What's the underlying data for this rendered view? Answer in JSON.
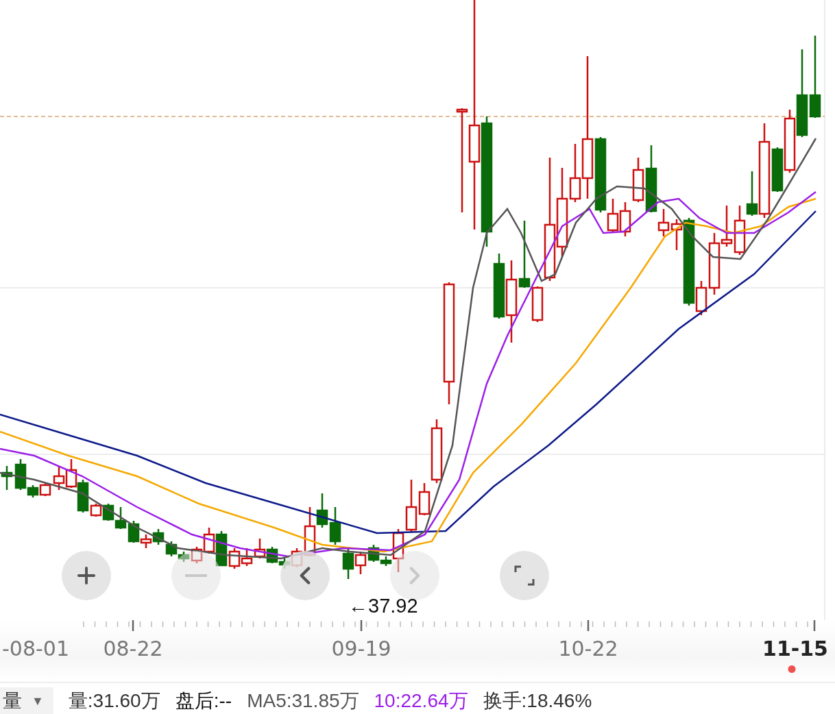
{
  "chart": {
    "price_marker": "←37.92",
    "controls": [
      {
        "kind": "zoom_in",
        "disabled": false
      },
      {
        "kind": "zoom_out",
        "disabled": true
      },
      {
        "kind": "prev",
        "disabled": false
      },
      {
        "kind": "next",
        "disabled": true
      },
      {
        "kind": "fullscreen",
        "disabled": false
      }
    ]
  },
  "x_axis": {
    "labels": [
      {
        "text": "-08-01",
        "selected": false
      },
      {
        "text": "08-22",
        "selected": false
      },
      {
        "text": "09-19",
        "selected": false
      },
      {
        "text": "10-22",
        "selected": false
      },
      {
        "text": "11-15",
        "selected": true
      }
    ]
  },
  "indicator_bar": {
    "selector": {
      "label": "量",
      "caret": "▼"
    },
    "items": [
      {
        "text": "量:31.60万",
        "color": "#333333"
      },
      {
        "text": "盘后:--",
        "color": "#111111"
      },
      {
        "text": "MA5:31.85万",
        "color": "#555555"
      },
      {
        "text": "10:22.64万",
        "color": "#9b1fe8"
      },
      {
        "text": "换手:18.46%",
        "color": "#333333"
      }
    ]
  }
}
